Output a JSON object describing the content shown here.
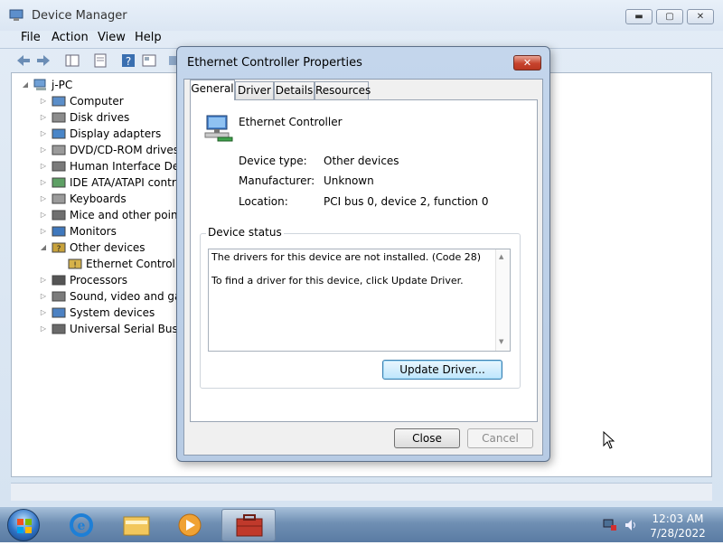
{
  "window": {
    "title": "Device Manager",
    "controls": {
      "minimize": "▬",
      "maximize": "▢",
      "close": "✕"
    }
  },
  "menu": [
    "File",
    "Action",
    "View",
    "Help"
  ],
  "toolbar_icons": [
    "back-arrow-icon",
    "forward-arrow-icon",
    "show-hide-tree-icon",
    "properties-icon",
    "help-icon",
    "console-icon",
    "update-driver-icon"
  ],
  "tree": {
    "root": "j-PC",
    "items": [
      {
        "label": "Computer",
        "icon": "computer-icon",
        "color": "#5b8ec9"
      },
      {
        "label": "Disk drives",
        "icon": "disk-drive-icon",
        "color": "#8c8c8c"
      },
      {
        "label": "Display adapters",
        "icon": "display-adapter-icon",
        "color": "#4a86c8"
      },
      {
        "label": "DVD/CD-ROM drives",
        "icon": "dvd-drive-icon",
        "color": "#9a9a9a"
      },
      {
        "label": "Human Interface Devic",
        "icon": "hid-icon",
        "color": "#7a7a7a"
      },
      {
        "label": "IDE ATA/ATAPI contro",
        "icon": "ide-controller-icon",
        "color": "#5ea065"
      },
      {
        "label": "Keyboards",
        "icon": "keyboard-icon",
        "color": "#9b9b9b"
      },
      {
        "label": "Mice and other pointin",
        "icon": "mouse-icon",
        "color": "#6f6f6f"
      },
      {
        "label": "Monitors",
        "icon": "monitor-icon",
        "color": "#3f78bd"
      },
      {
        "label": "Other devices",
        "icon": "other-devices-icon",
        "color": "#c8a23c"
      },
      {
        "label": "Ethernet Controller",
        "icon": "warning-device-icon",
        "color": "#d6b24a",
        "child": true
      },
      {
        "label": "Processors",
        "icon": "processor-icon",
        "color": "#555555"
      },
      {
        "label": "Sound, video and gam",
        "icon": "sound-icon",
        "color": "#7c7c7c"
      },
      {
        "label": "System devices",
        "icon": "system-devices-icon",
        "color": "#4d82c3"
      },
      {
        "label": "Universal Serial Bus co",
        "icon": "usb-icon",
        "color": "#6a6a6a"
      }
    ]
  },
  "dialog": {
    "title": "Ethernet Controller Properties",
    "close_glyph": "✕",
    "tabs": [
      "General",
      "Driver",
      "Details",
      "Resources"
    ],
    "active_tab": "General",
    "device_name": "Ethernet Controller",
    "properties": [
      {
        "label": "Device type:",
        "value": "Other devices"
      },
      {
        "label": "Manufacturer:",
        "value": "Unknown"
      },
      {
        "label": "Location:",
        "value": "PCI bus 0, device 2, function 0"
      }
    ],
    "status_group": "Device status",
    "status_lines": [
      "The drivers for this device are not installed. (Code 28)",
      "To find a driver for this device, click Update Driver."
    ],
    "update_button": "Update Driver...",
    "close_button": "Close",
    "cancel_button": "Cancel"
  },
  "taskbar": {
    "apps": [
      "internet-explorer-icon",
      "windows-explorer-icon",
      "media-player-icon",
      "device-manager-icon"
    ],
    "active_app": "device-manager-icon",
    "tray_icons": [
      "network-warning-icon",
      "volume-icon"
    ],
    "time": "12:03 AM",
    "date": "7/28/2022"
  },
  "colors": {
    "dialog_frame": "#b7cbe4",
    "taskbar": "#6f8fb3",
    "close_red": "#c7432d",
    "focus_button": "#bee6fd"
  }
}
